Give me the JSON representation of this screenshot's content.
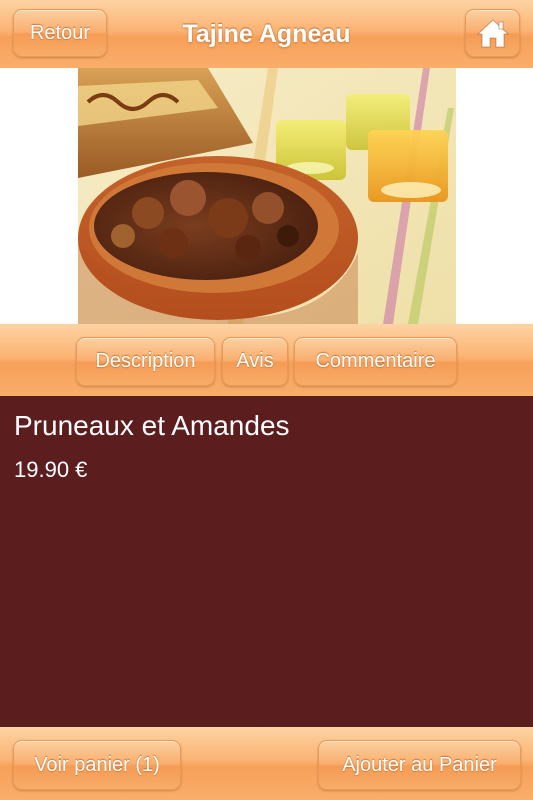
{
  "header": {
    "back_label": "Retour",
    "title": "Tajine Agneau",
    "home_icon": "home-icon"
  },
  "image": {
    "subject": "tajine-dish-photo"
  },
  "tabs": [
    {
      "label": "Description"
    },
    {
      "label": "Avis"
    },
    {
      "label": "Commentaire"
    }
  ],
  "item": {
    "name": "Pruneaux et Amandes",
    "price": "19.90 €"
  },
  "footer": {
    "cart_label": "Voir panier (1)",
    "add_label": "Ajouter au Panier"
  },
  "colors": {
    "accent_orange": "#f9ae6a",
    "content_background": "#5c1d1f",
    "text": "#ffffff"
  }
}
